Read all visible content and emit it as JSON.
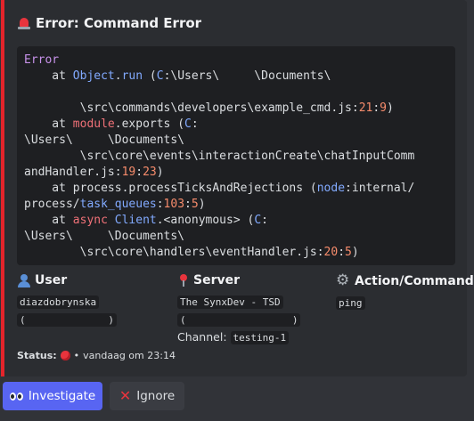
{
  "embed": {
    "title": "Error: Command Error",
    "accent_color": "#e3242b",
    "title_icon": "siren-icon"
  },
  "stack": {
    "l1": "Error",
    "l2a": "    at ",
    "l2b": "Object",
    "l2c": ".",
    "l2d": "run",
    "l2e": " (",
    "l2f": "C",
    "l2g": ":\\Users\\     \\Documents\\",
    "l3": "",
    "l4a": "        \\src\\commands\\developers\\example_cmd.js:",
    "l4b": "21",
    "l4c": ":",
    "l4d": "9",
    "l4e": ")",
    "l5a": "    at ",
    "l5b": "module",
    "l5c": ".exports (",
    "l5d": "C",
    "l5e": ":",
    "l6": "\\Users\\     \\Documents\\",
    "l7": "        \\src\\core\\events\\interactionCreate\\chatInputComm",
    "l8a": "andHandler.js:",
    "l8b": "19",
    "l8c": ":",
    "l8d": "23",
    "l8e": ")",
    "l9a": "    at process.processTicksAndRejections (",
    "l9b": "node",
    "l9c": ":internal/",
    "l10a": "process/",
    "l10b": "task_queues",
    "l10c": ":",
    "l10d": "103",
    "l10e": ":",
    "l10f": "5",
    "l10g": ")",
    "l11a": "    at ",
    "l11b": "async",
    "l11c": " ",
    "l11d": "Client",
    "l11e": ".<anonymous> (",
    "l11f": "C",
    "l11g": ":",
    "l12": "\\Users\\     \\Documents\\",
    "l13a": "        \\src\\core\\handlers\\eventHandler.js:",
    "l13b": "20",
    "l13c": ":",
    "l13d": "5",
    "l13e": ")"
  },
  "fields": {
    "user": {
      "name": "User",
      "icon": "user-icon",
      "value1": "diazdobrynska",
      "value2": "(              )"
    },
    "server": {
      "name": "Server",
      "icon": "pin-icon",
      "value1": "The SynxDev - TSD",
      "value2": "(                  )",
      "channel_label": "Channel:",
      "channel_value": "testing-1"
    },
    "action": {
      "name": "Action/Command",
      "icon": "gear-icon",
      "value1": "ping"
    }
  },
  "status": {
    "label": "Status:",
    "separator": "•",
    "timestamp": "vandaag om 23:14",
    "icon": "red-circle-icon"
  },
  "buttons": {
    "investigate": {
      "label": "Investigate",
      "icon": "eyes-icon",
      "color": "#5865f2"
    },
    "ignore": {
      "label": "Ignore",
      "icon": "x-icon"
    }
  }
}
